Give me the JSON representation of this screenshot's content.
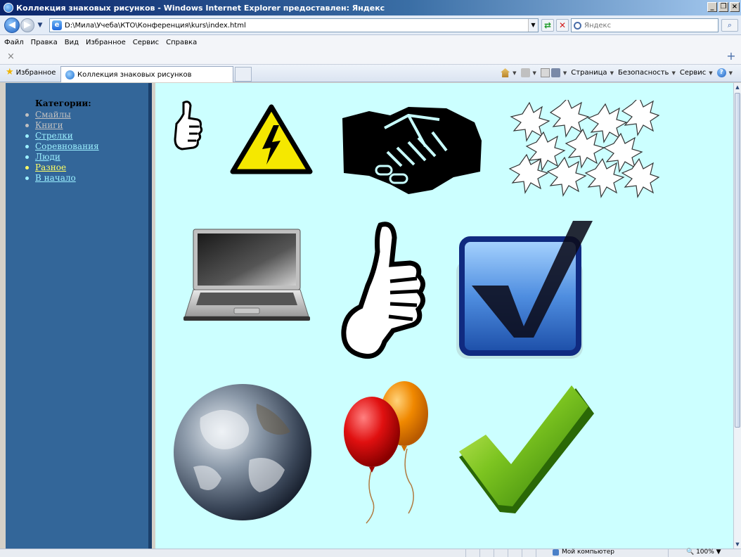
{
  "window": {
    "title": "Коллекция знаковых рисунков - Windows Internet Explorer предоставлен: Яндекс",
    "buttons": {
      "minimize": "_",
      "maximize": "❐",
      "close": "×"
    }
  },
  "address_bar": {
    "url": "D:\\Мила\\Учеба\\КТО\\Конференция\\kurs\\index.html",
    "search_placeholder": "Яндекс"
  },
  "menu": {
    "items": [
      "Файл",
      "Правка",
      "Вид",
      "Избранное",
      "Сервис",
      "Справка"
    ]
  },
  "favorites_label": "Избранное",
  "tab": {
    "label": "Коллекция знаковых рисунков"
  },
  "command_bar": {
    "page": "Страница",
    "safety": "Безопасность",
    "tools": "Сервис"
  },
  "sidebar": {
    "heading": "Категории:",
    "items": [
      {
        "label": "Смайлы",
        "state": "visited"
      },
      {
        "label": "Книги",
        "state": "visited"
      },
      {
        "label": "Стрелки",
        "state": "normal"
      },
      {
        "label": "Соревнования",
        "state": "normal"
      },
      {
        "label": "Люди",
        "state": "normal"
      },
      {
        "label": "Разное",
        "state": "active"
      },
      {
        "label": "В начало",
        "state": "normal"
      }
    ]
  },
  "gallery": {
    "images": [
      "thumbs-up-small-icon",
      "high-voltage-warning-icon",
      "handshake-icon",
      "maple-leaves-icon",
      "laptop-icon",
      "thumbs-up-large-icon",
      "blue-checkbox-icon",
      "earth-globe-icon",
      "balloons-icon",
      "green-checkmark-icon"
    ]
  },
  "status_bar": {
    "zone": "Мой компьютер",
    "zoom": "100%"
  },
  "colors": {
    "sidebar_bg": "#336699",
    "content_bg": "#ccffff",
    "link": "#9cf0ff",
    "link_visited": "#c0c0c0",
    "link_active": "#ffff66"
  }
}
